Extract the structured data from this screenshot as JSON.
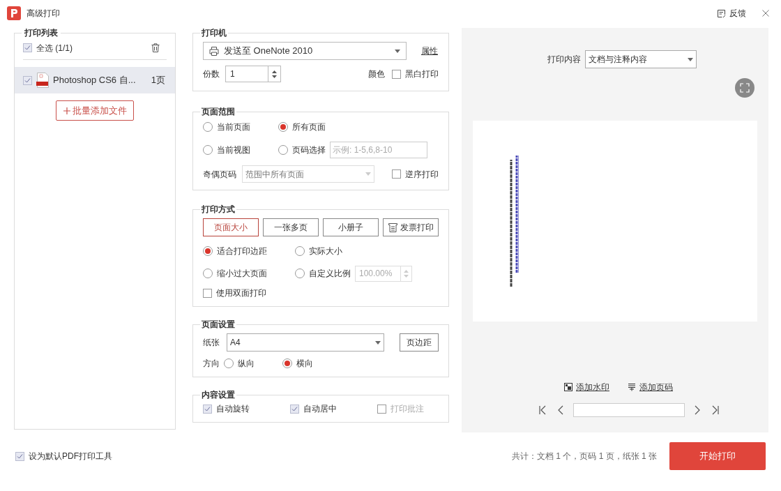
{
  "window": {
    "title": "高级打印",
    "feedback": "反馈"
  },
  "print_list": {
    "title": "打印列表",
    "select_all": {
      "label": "全选 (1/1)",
      "checked": true
    },
    "files": [
      {
        "name": "Photoshop CS6 自...",
        "pages": "1页",
        "checked": true,
        "selected": true
      }
    ],
    "add_button": "批量添加文件"
  },
  "printer": {
    "title": "打印机",
    "printer": "发送至 OneNote 2010",
    "properties": "属性",
    "copies_label": "份数",
    "copies": "1",
    "color_label": "颜色",
    "grayscale": {
      "label": "黑白打印",
      "checked": false
    }
  },
  "page_range": {
    "title": "页面范围",
    "options": [
      {
        "label": "当前页面",
        "selected": false
      },
      {
        "label": "所有页面",
        "selected": true
      },
      {
        "label": "当前视图",
        "selected": false
      },
      {
        "label": "页码选择",
        "selected": false
      }
    ],
    "page_input_placeholder": "示例: 1-5,6,8-10",
    "odd_even_label": "奇偶页码",
    "odd_even": "范围中所有页面",
    "reverse": {
      "label": "逆序打印",
      "checked": false
    }
  },
  "print_mode": {
    "title": "打印方式",
    "modes": [
      {
        "label": "页面大小",
        "selected": true,
        "kind": "plain"
      },
      {
        "label": "一张多页",
        "selected": false,
        "kind": "plain"
      },
      {
        "label": "小册子",
        "selected": false,
        "kind": "plain"
      },
      {
        "label": "发票打印",
        "selected": false,
        "kind": "invoice"
      }
    ],
    "scaling": [
      {
        "label": "适合打印边距",
        "selected": true
      },
      {
        "label": "实际大小",
        "selected": false
      },
      {
        "label": "缩小过大页面",
        "selected": false
      },
      {
        "label": "自定义比例",
        "selected": false
      }
    ],
    "scale": "100.00%",
    "duplex": {
      "label": "使用双面打印",
      "checked": false
    }
  },
  "page_setup": {
    "title": "页面设置",
    "paper_label": "纸张",
    "paper": "A4",
    "margins_button": "页边距",
    "orientation_label": "方向",
    "orientations": [
      {
        "label": "纵向",
        "selected": false
      },
      {
        "label": "横向",
        "selected": true
      }
    ]
  },
  "content_settings": {
    "title": "内容设置",
    "options": [
      {
        "label": "自动旋转",
        "checked": true
      },
      {
        "label": "自动居中",
        "checked": true
      },
      {
        "label": "打印批注",
        "checked": false
      }
    ]
  },
  "preview": {
    "content_label": "打印内容",
    "content": "文档与注释内容",
    "add_watermark": "添加水印",
    "add_page_number": "添加页码"
  },
  "footer": {
    "default_tool": {
      "label": "设为默认PDF打印工具",
      "checked": true
    },
    "summary": "共计：文档 1 个，页码 1 页，纸张 1 张",
    "start_button": "开始打印"
  }
}
